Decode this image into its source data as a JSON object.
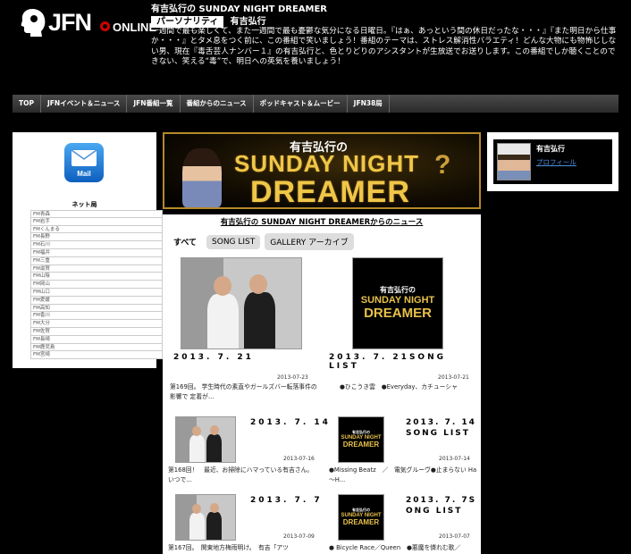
{
  "header": {
    "logo_text": "JFN",
    "logo_sub": "ONLINE",
    "program_title": "有吉弘行の SUNDAY NIGHT DREAMER",
    "personality_label": "パーソナリティ",
    "personality_name": "有吉弘行",
    "description": "一週間で最も楽しくて、また一週間で最も憂鬱な気分になる日曜日。『はぁ、あっという間の休日だったな・・・』『また明日から仕事か・・・』とタメ息をつく前に、この番組で笑いましょう！番組のテーマは、ストレス解消性バラエティ！どんな大物にも物怖じしない男、現在『毒舌芸人ナンバー１』の有吉弘行と、色とりどりのアシスタントが生放送でお送りします。この番組でしか聴くことのできない、笑える“毒”で、明日への英気を養いましょう！"
  },
  "nav": [
    "TOP",
    "JFNイベント＆ニュース",
    "JFN番組一覧",
    "番組からのニュース",
    "ポッドキャスト＆ムービー",
    "JFN38局"
  ],
  "sidebar": {
    "mail_label": "Mail",
    "net_title": "ネット局",
    "stations": [
      "FM青森",
      "FM岩手",
      "FMくんまる",
      "FM長野",
      "FM石川",
      "FM福井",
      "FM三重",
      "FM滋賀",
      "FM山陰",
      "FM岡山",
      "FM山口",
      "FM愛媛",
      "FM高知",
      "FM香川",
      "FM大分",
      "FM佐賀",
      "FM長崎",
      "FM鹿児島",
      "FM宮崎"
    ]
  },
  "banner": {
    "small": "有吉弘行の",
    "line1": "SUNDAY NIGHT",
    "line2": "DREAMER",
    "q": "?"
  },
  "main": {
    "news_title": "有吉弘行の SUNDAY NIGHT DREAMERからのニュース",
    "tabs": [
      "すべて",
      "SONG LIST",
      "GALLERY アーカイブ"
    ],
    "items": [
      {
        "title": "2013. 7. 21",
        "date": "2013-07-23",
        "text": "第169回。 学生時代の素直やガールズバー転落事件の影響で 定着が..."
      },
      {
        "title": "2013. 7. 21SONG LIST",
        "date": "2013-07-21",
        "text": "●ひこうき雲　●Everyday、カチューシャ"
      },
      {
        "title": "2013. 7. 14",
        "date": "2013-07-16",
        "text": "第168回！　最近、お掃除にハマっている有吉さん。　いつで..."
      },
      {
        "title": "2013. 7. 14 SONG LIST",
        "title_l1": "2013. 7. 14",
        "title_l2": "SONG LIST",
        "date": "2013-07-14",
        "text": "●Missing Beatz　／　電気グルーヴ●止まらない Ha～H..."
      },
      {
        "title": "2013. 7. 7",
        "date": "2013-07-09",
        "text": "第167回。　関東地方梅雨明け。　有吉「アツ"
      },
      {
        "title": "2013. 7. 7S ONG LIST",
        "title_l1": "2013. 7. 7S",
        "title_l2": "ONG LIST",
        "date": "2013-07-07",
        "text": "● Bicycle Race／Queen　●悪魔を憐れむ歌／"
      }
    ],
    "thumb_logo_small": "有吉弘行の",
    "thumb_logo_l1": "SUNDAY NIGHT",
    "thumb_logo_l2": "DREAMER"
  },
  "profile": {
    "name": "有吉弘行",
    "link": "プロフィール"
  }
}
